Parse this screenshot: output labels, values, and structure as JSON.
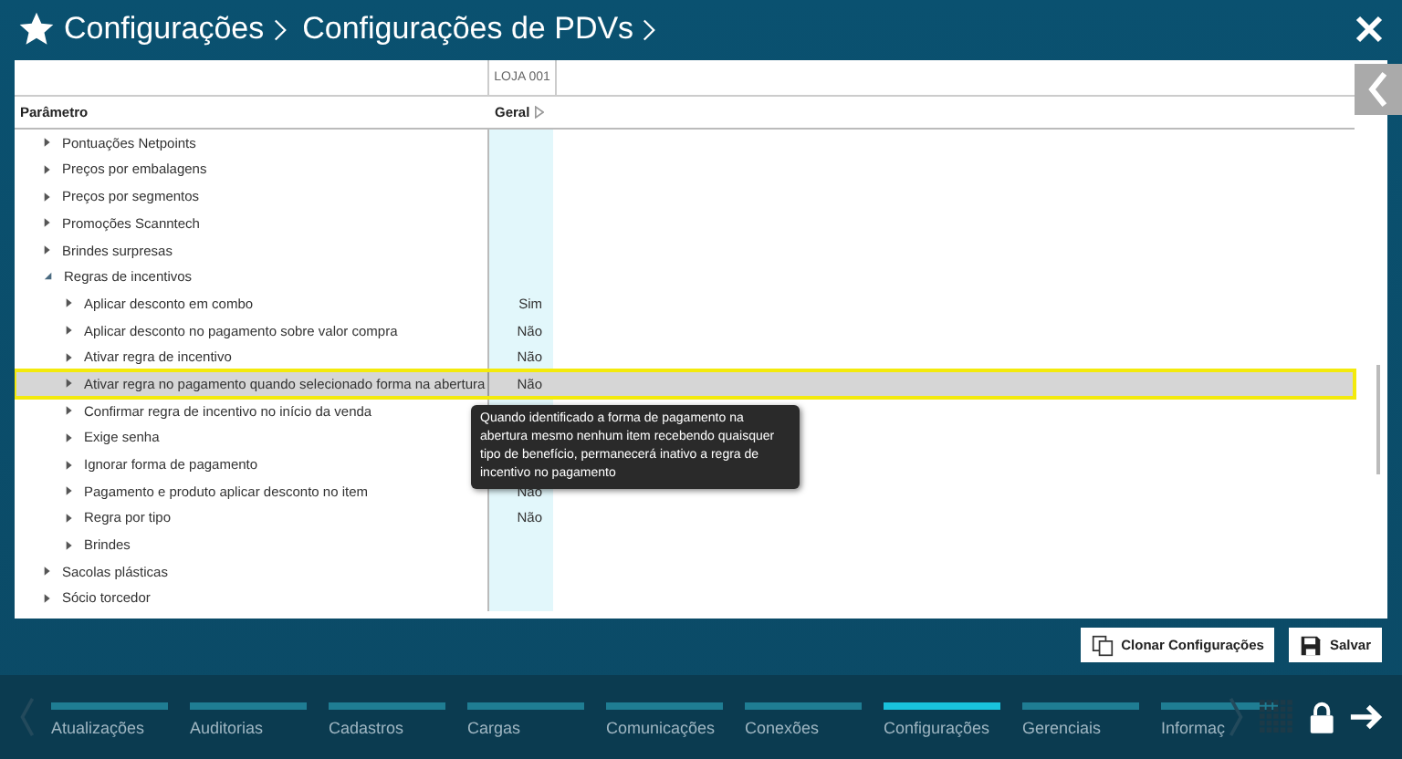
{
  "header": {
    "breadcrumb": [
      "Configurações",
      "Configurações de PDVs"
    ]
  },
  "grid": {
    "store_column": "LOJA 001",
    "param_header": "Parâmetro",
    "value_header": "Geral",
    "rows": [
      {
        "label": "Pontuações Netpoints",
        "expanded": false
      },
      {
        "label": "Preços por embalagens",
        "expanded": false
      },
      {
        "label": "Preços por segmentos",
        "expanded": false
      },
      {
        "label": "Promoções Scanntech",
        "expanded": false
      },
      {
        "label": "Brindes surpresas",
        "expanded": false
      },
      {
        "label": "Regras de incentivos",
        "expanded": true,
        "children": [
          {
            "label": "Aplicar desconto em combo",
            "value": "Sim",
            "selected": false
          },
          {
            "label": "Aplicar desconto no pagamento sobre valor compra",
            "value": "Não",
            "selected": false
          },
          {
            "label": "Ativar regra de incentivo",
            "value": "Não",
            "selected": false
          },
          {
            "label": "Ativar regra no pagamento quando selecionado forma na abertura",
            "value": "Não",
            "selected": true
          },
          {
            "label": "Confirmar regra de incentivo no início da venda",
            "selected": false
          },
          {
            "label": "Exige senha",
            "selected": false
          },
          {
            "label": "Ignorar forma de pagamento",
            "selected": false
          },
          {
            "label": "Pagamento e produto aplicar desconto no item",
            "value": "Não",
            "selected": false
          },
          {
            "label": "Regra por tipo",
            "value": "Não",
            "selected": false
          },
          {
            "label": "Brindes",
            "selected": false
          }
        ]
      },
      {
        "label": "Sacolas plásticas",
        "expanded": false
      },
      {
        "label": "Sócio torcedor",
        "expanded": false
      }
    ]
  },
  "tooltip": "Quando identificado a forma de pagamento na abertura mesmo nenhum item recebendo quaisquer tipo de benefício, permanecerá inativo a regra de incentivo no pagamento",
  "buttons": [
    "Clonar Configurações",
    "Salvar"
  ],
  "nav_tabs": [
    {
      "label": "Atualizações",
      "selected": false
    },
    {
      "label": "Auditorias",
      "selected": false
    },
    {
      "label": "Cadastros",
      "selected": false
    },
    {
      "label": "Cargas",
      "selected": false
    },
    {
      "label": "Comunicações",
      "selected": false
    },
    {
      "label": "Conexões",
      "selected": false
    },
    {
      "label": "Configurações",
      "selected": true
    },
    {
      "label": "Gerenciais",
      "selected": false
    },
    {
      "label": "Informaç",
      "selected": false
    }
  ]
}
